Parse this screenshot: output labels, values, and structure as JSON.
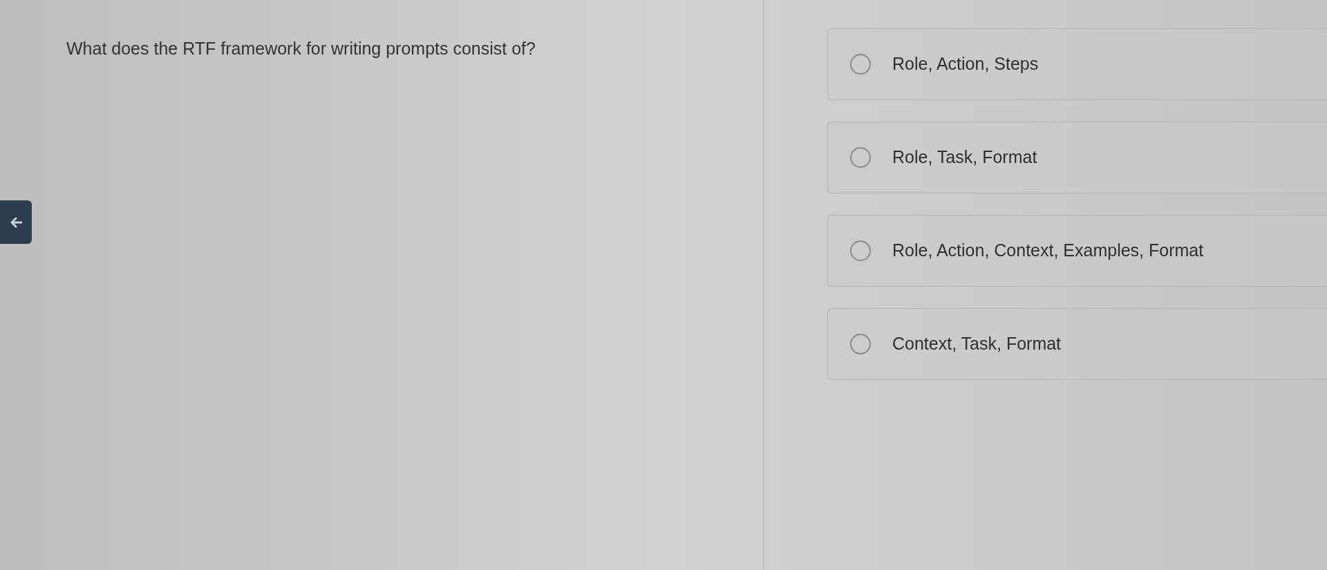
{
  "question": {
    "text": "What does the RTF framework for writing prompts consist of?"
  },
  "options": [
    {
      "label": "Role, Action, Steps",
      "selected": false
    },
    {
      "label": "Role, Task, Format",
      "selected": false
    },
    {
      "label": "Role, Action, Context, Examples, Format",
      "selected": false
    },
    {
      "label": "Context, Task, Format",
      "selected": false
    }
  ]
}
